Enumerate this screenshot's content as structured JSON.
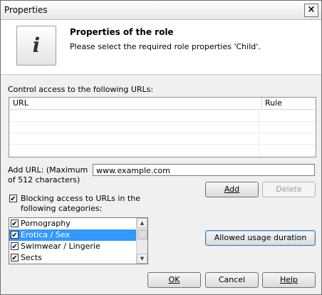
{
  "window": {
    "title": "Properties",
    "close_glyph": "×"
  },
  "header": {
    "icon_glyph": "i",
    "title": "Properties of the role",
    "subtitle": "Please select the required role properties 'Child'."
  },
  "urls": {
    "label": "Control access to the following URLs:",
    "columns": [
      "URL",
      "Rule"
    ],
    "rows": []
  },
  "add_url": {
    "label_line1": "Add URL: (Maximum",
    "label_line2": "of 512 characters)",
    "value": "www.example.com",
    "add_button": "Add",
    "delete_button": "Delete"
  },
  "blocking": {
    "checked": true,
    "label_line1": "Blocking access to URLs in the",
    "label_line2": "following categories:",
    "categories": [
      {
        "label": "Pornography",
        "checked": true,
        "selected": false
      },
      {
        "label": "Erotica / Sex",
        "checked": true,
        "selected": true
      },
      {
        "label": "Swimwear / Lingerie",
        "checked": true,
        "selected": false
      },
      {
        "label": "Sects",
        "checked": true,
        "selected": false
      }
    ]
  },
  "usage_button": "Allowed usage duration",
  "footer": {
    "ok": "OK",
    "cancel": "Cancel",
    "help": "Help"
  },
  "check_glyph": "✔"
}
